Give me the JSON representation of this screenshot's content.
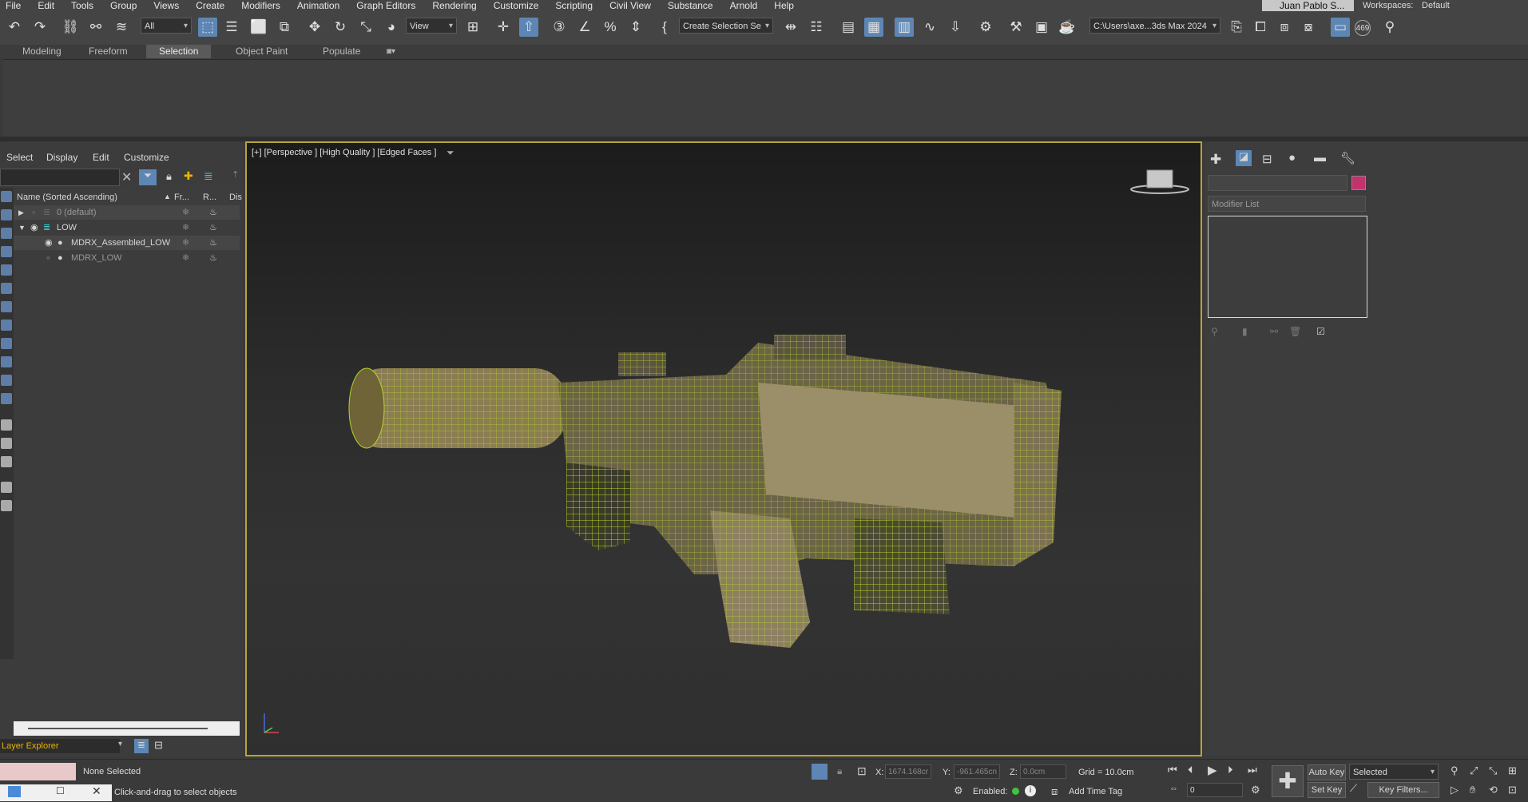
{
  "menu": [
    "File",
    "Edit",
    "Tools",
    "Group",
    "Views",
    "Create",
    "Modifiers",
    "Animation",
    "Graph Editors",
    "Rendering",
    "Customize",
    "Scripting",
    "Civil View",
    "Substance",
    "Arnold",
    "Help"
  ],
  "user": "Juan Pablo S...",
  "workspaces_label": "Workspaces:",
  "workspace": "Default",
  "toolbar": {
    "filter": "All",
    "view": "View",
    "selection_set": "Create Selection Se",
    "project_path": "C:\\Users\\axe...3ds Max 2024",
    "count_badge": "469"
  },
  "ribbon_tabs": [
    "Modeling",
    "Freeform",
    "Selection",
    "Object Paint",
    "Populate"
  ],
  "explorer": {
    "menus": [
      "Select",
      "Display",
      "Edit",
      "Customize"
    ],
    "columns": {
      "name": "Name (Sorted Ascending)",
      "frozen": "Fr...",
      "render": "R...",
      "display": "Dis"
    },
    "rows": [
      "0 (default)",
      "LOW",
      "MDRX_Assembled_LOW",
      "MDRX_LOW"
    ],
    "footer": "Layer Explorer"
  },
  "viewport": {
    "label": "[+] [Perspective ] [High Quality ] [Edged Faces ]"
  },
  "command_panel": {
    "modifier_list": "Modifier List"
  },
  "status": {
    "selection": "None Selected",
    "prompt": "Click-and-drag to select objects",
    "x_label": "X:",
    "x_value": "1674.168cr",
    "y_label": "Y:",
    "y_value": "-961.465cn",
    "z_label": "Z:",
    "z_value": "0.0cm",
    "grid": "Grid = 10.0cm",
    "enabled": "Enabled:",
    "add_time_tag": "Add Time Tag",
    "auto_key": "Auto Key",
    "set_key": "Set Key",
    "key_mode": "Selected",
    "key_filters": "Key Filters...",
    "frame": "0"
  }
}
